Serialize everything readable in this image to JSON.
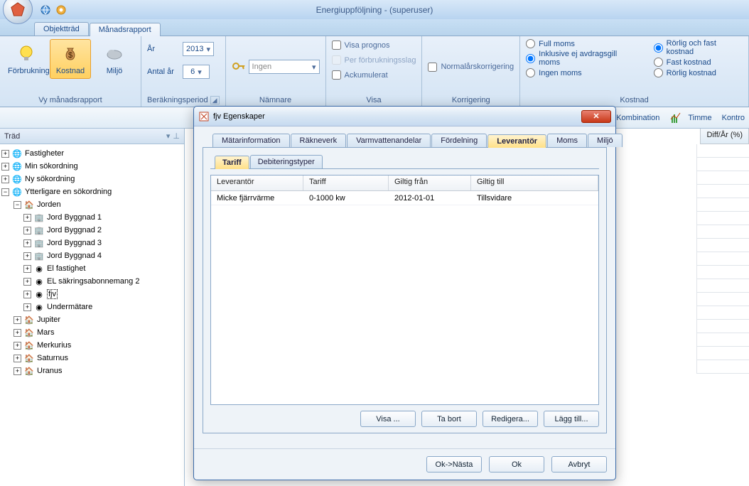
{
  "app": {
    "title": "Energiuppföljning -  (superuser)"
  },
  "docTabs": {
    "objekttrad": "Objektträd",
    "manadsrapport": "Månadsrapport"
  },
  "ribbon": {
    "vy": {
      "label": "Vy månadsrapport",
      "forbrukning": "Förbrukning",
      "kostnad": "Kostnad",
      "miljo": "Miljö"
    },
    "period": {
      "label": "Beräkningsperiod",
      "ar": "År",
      "ar_val": "2013",
      "antal_ar": "Antal år",
      "antal_ar_val": "6"
    },
    "namnare": {
      "label": "Nämnare",
      "val": "Ingen"
    },
    "visa": {
      "label": "Visa",
      "prognos": "Visa prognos",
      "perforbrukning": "Per förbrukningsslag",
      "ackumulerat": "Ackumulerat"
    },
    "korrigering": {
      "label": "Korrigering",
      "normal": "Normalårskorrigering"
    },
    "kostnad": {
      "label": "Kostnad",
      "full_moms": "Full moms",
      "inkl": "Inklusive ej avdragsgill moms",
      "ingen_moms": "Ingen moms",
      "rorlig_fast": "Rörlig och fast kostnad",
      "fast": "Fast kostnad",
      "rorlig": "Rörlig kostnad"
    }
  },
  "toolbar2": {
    "kombination": "Kombination",
    "timme": "Timme",
    "kontro": "Kontro"
  },
  "treeTitle": "Träd",
  "tree": {
    "fastigheter": "Fastigheter",
    "min": "Min sökordning",
    "ny": "Ny sökordning",
    "ytter": "Ytterligare en sökordning",
    "jorden": "Jorden",
    "b1": "Jord Byggnad 1",
    "b2": "Jord Byggnad 2",
    "b3": "Jord Byggnad 3",
    "b4": "Jord Byggnad 4",
    "el": "El fastighet",
    "elsak": "EL säkringsabonnemang 2",
    "fjv": "fjv",
    "under": "Undermätare",
    "jupiter": "Jupiter",
    "mars": "Mars",
    "merkurius": "Merkurius",
    "saturnus": "Saturnus",
    "uranus": "Uranus"
  },
  "gridHeader": {
    "diff": "Diff/År (%)"
  },
  "dialog": {
    "title": "fjv Egenskaper",
    "tabs": {
      "matar": "Mätarinformation",
      "rakneverk": "Räkneverk",
      "varm": "Varmvattenandelar",
      "fordelning": "Fördelning",
      "leverantor": "Leverantör",
      "moms": "Moms",
      "miljo": "Miljö"
    },
    "subtabs": {
      "tariff": "Tariff",
      "debit": "Debiteringstyper"
    },
    "cols": {
      "lev": "Leverantör",
      "tariff": "Tariff",
      "from": "Giltig från",
      "till": "Giltig till"
    },
    "row": {
      "lev": "Micke fjärrvärme",
      "tariff": "0-1000 kw",
      "from": "2012-01-01",
      "till": "Tillsvidare"
    },
    "btns": {
      "visa": "Visa ...",
      "tabort": "Ta bort",
      "redigera": "Redigera...",
      "lagg": "Lägg till..."
    },
    "actions": {
      "oknasta": "Ok->Nästa",
      "ok": "Ok",
      "avbryt": "Avbryt"
    }
  }
}
